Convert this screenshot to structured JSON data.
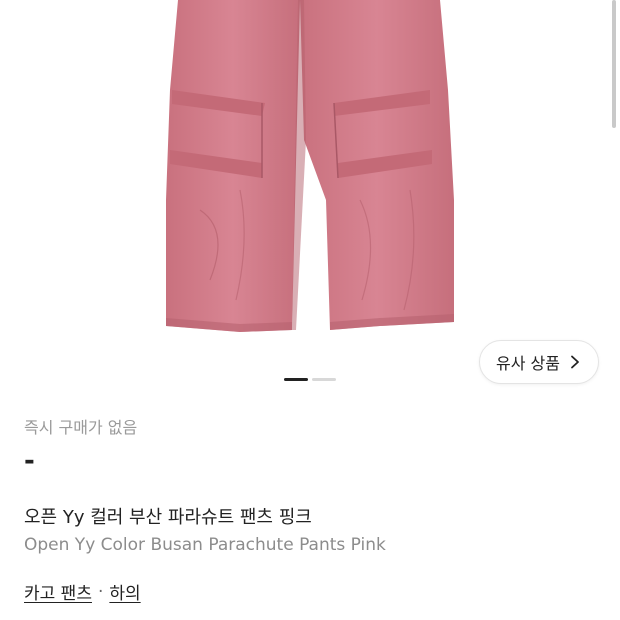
{
  "similar_button": {
    "label": "유사 상품",
    "icon": "chevron-right-icon"
  },
  "carousel": {
    "total": 2,
    "current": 1
  },
  "product": {
    "instant_purchase": "즉시 구매가 없음",
    "price": "-",
    "name_ko": "오픈 Yy 컬러 부산 파라슈트 팬츠 핑크",
    "name_en": "Open Yy Color Busan Parachute Pants Pink"
  },
  "breadcrumb": {
    "category": "카고 팬츠",
    "separator": "·",
    "parent": "하의"
  },
  "colors": {
    "pants": "#d47a86",
    "text": "#222222",
    "muted": "#9a9a9a"
  }
}
